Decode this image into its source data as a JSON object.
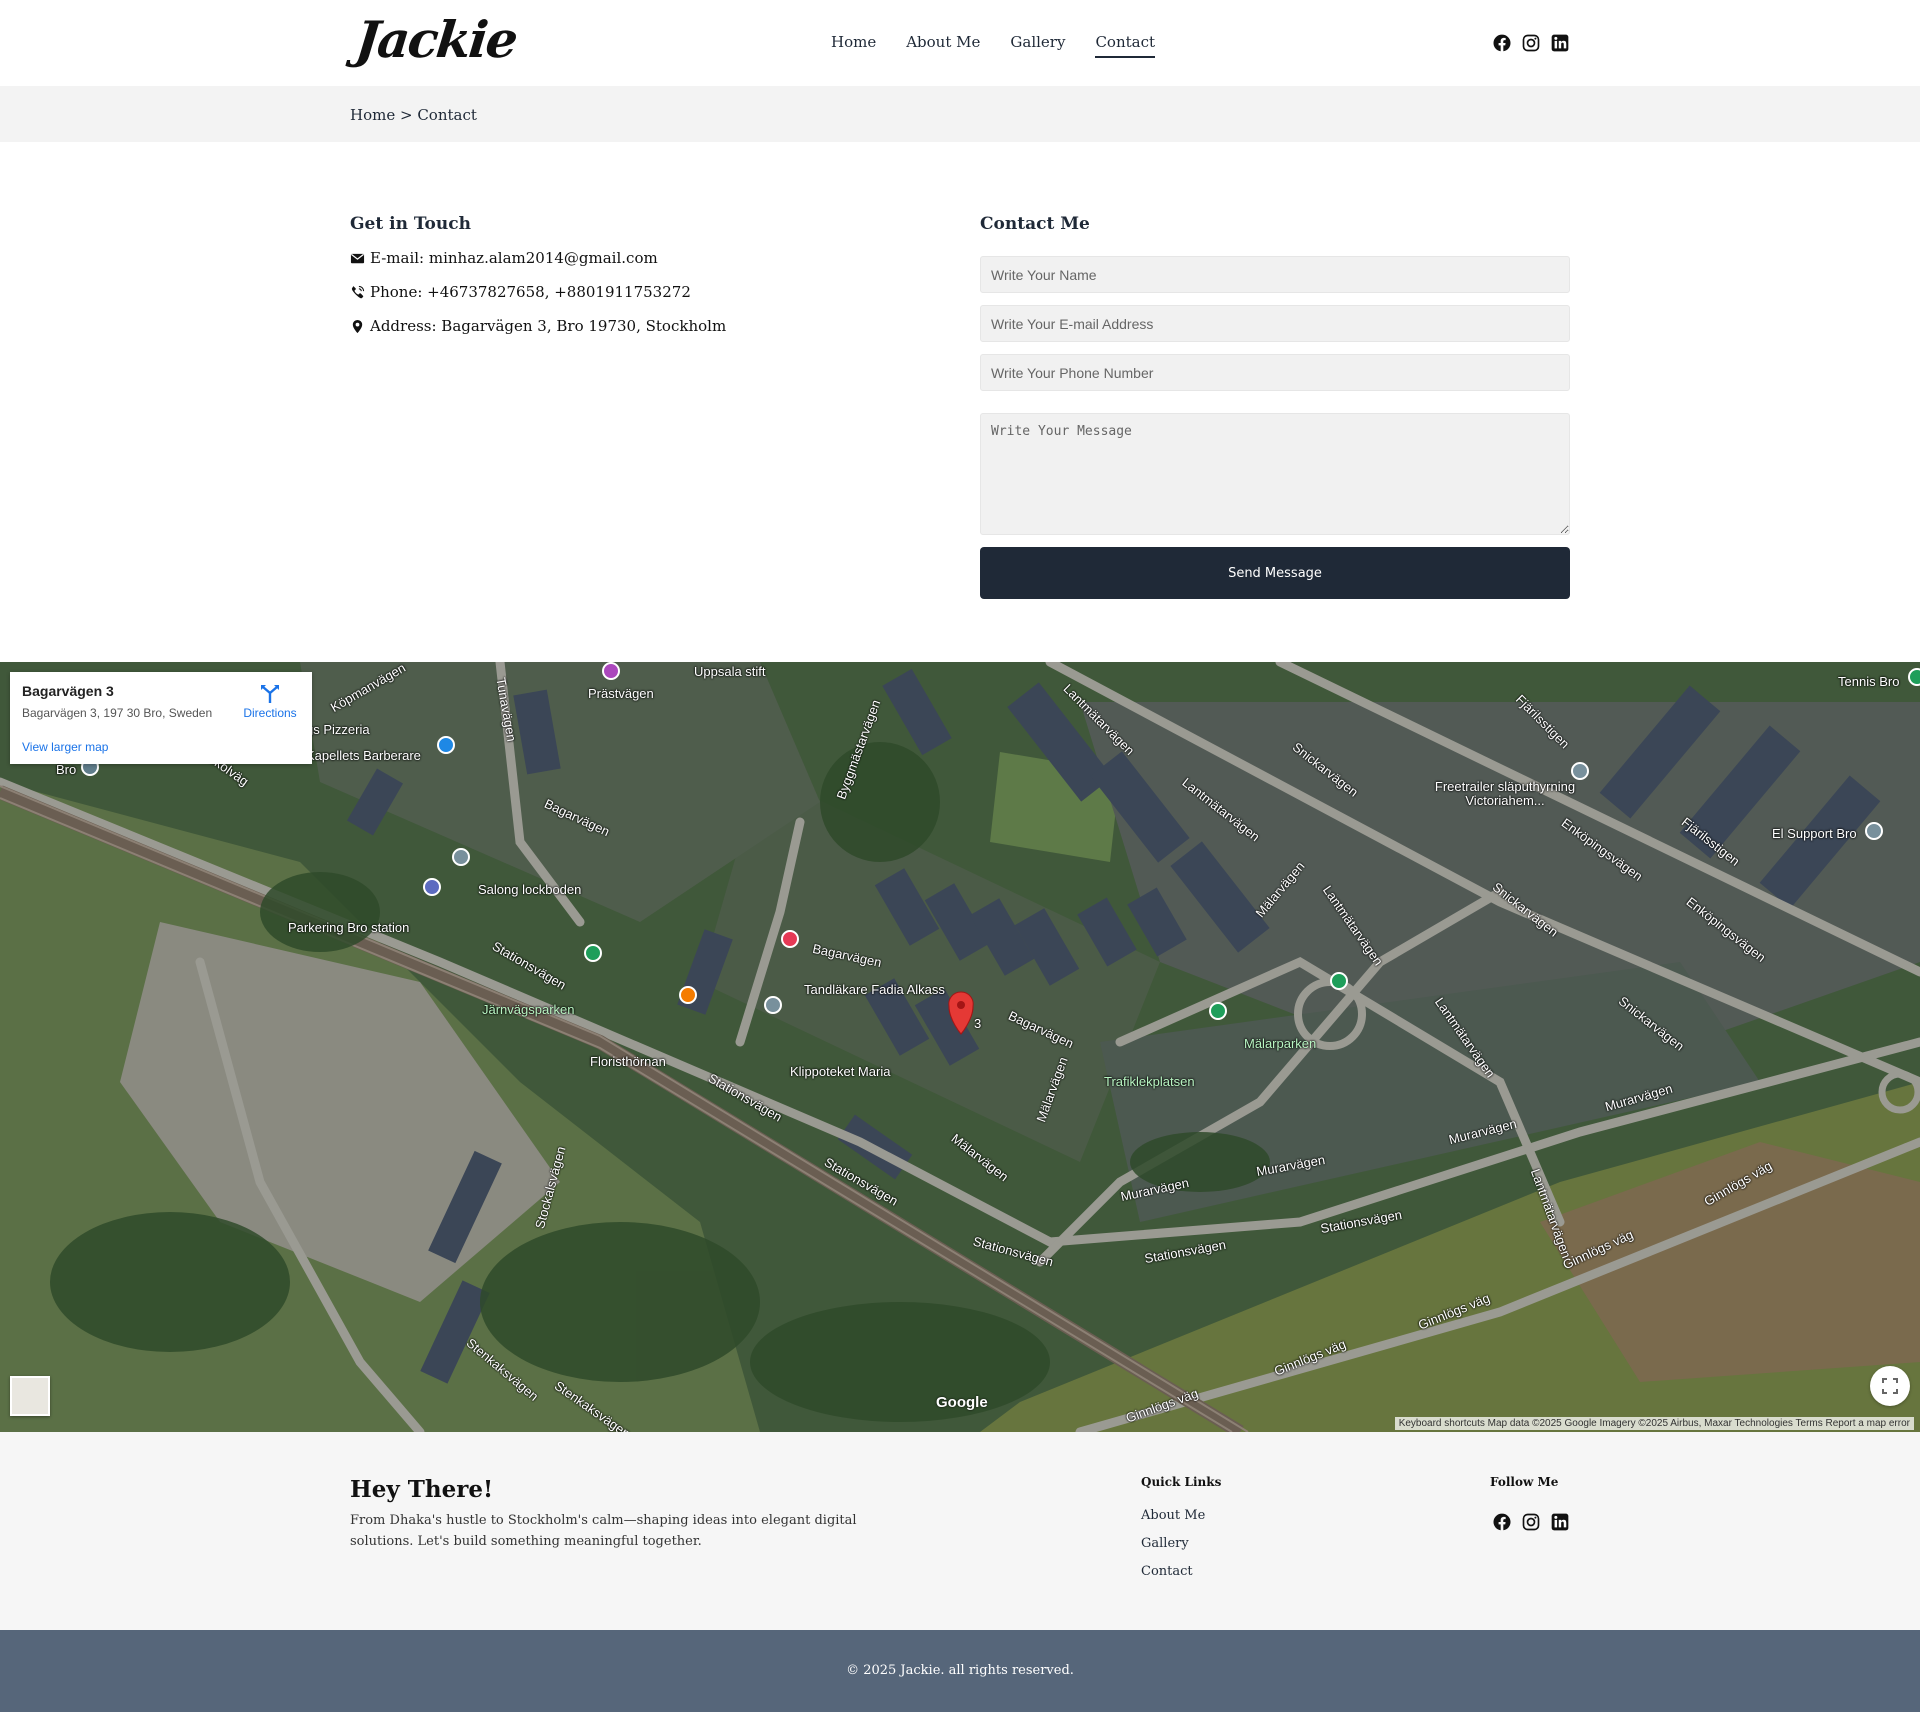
{
  "brand": {
    "logo": "Jackie"
  },
  "nav": {
    "items": [
      {
        "label": "Home"
      },
      {
        "label": "About Me"
      },
      {
        "label": "Gallery"
      },
      {
        "label": "Contact"
      }
    ]
  },
  "social": [
    "facebook-icon",
    "instagram-icon",
    "linkedin-icon"
  ],
  "breadcrumb": {
    "text": "Home > Contact"
  },
  "contact_info": {
    "title": "Get in Touch",
    "email": "E-mail: minhaz.alam2014@gmail.com",
    "phone": "Phone: +46737827658, +8801911753272",
    "address": "Address: Bagarvägen 3, Bro 19730, Stockholm"
  },
  "form": {
    "title": "Contact Me",
    "name_placeholder": "Write Your Name",
    "email_placeholder": "Write Your E-mail Address",
    "phone_placeholder": "Write Your Phone Number",
    "message_placeholder": "Write Your Message",
    "submit_label": "Send Message"
  },
  "map": {
    "card_title": "Bagarvägen 3",
    "card_address": "Bagarvägen 3, 197 30 Bro, Sweden",
    "directions_label": "Directions",
    "larger_map_label": "View larger map",
    "google_label": "Google",
    "attribution": "Keyboard shortcuts   Map data ©2025 Google Imagery ©2025 Airbus, Maxar Technologies   Terms   Report a map error",
    "labels": {
      "koepmanvagen": "Köpmanvägen",
      "pizzeria": "gs Pizzeria",
      "barberare": "Kapellets Barberare",
      "bro": "Bro",
      "skolvag": "Skolväg",
      "tunavagen": "Tunavägen",
      "prastvagen": "Prästvägen",
      "uppsala": "Uppsala stift",
      "byggmastarvagen": "Byggmästarvägen",
      "lantmatarvagen1": "Lantmätarvägen",
      "snickarvagen1": "Snickarvägen",
      "lantmatarvagen2": "Lantmätarvägen",
      "freetrailer": "Freetrailer släputhyrning Victoriahem...",
      "tennis": "Tennis Bro",
      "fjarilsstigen1": "Fjärilsstigen",
      "enkopingsvagen1": "Enköpingsvägen",
      "fjarilsstigen2": "Fjärilsstigen",
      "elsupport": "El Support Bro",
      "enkopingsvagen2": "Enköpingsvägen",
      "salong": "Salong lockboden",
      "parkering": "Parkering Bro station",
      "bagarvagen_top": "Bagarvägen",
      "stationsvagen1": "Stationsvägen",
      "jarnvagsparken": "Järnvägsparken",
      "bagarvagen2": "Bagarvägen",
      "tandlakare": "Tandläkare Fadia Alkass",
      "bagarvagen3": "Bagarvägen",
      "marker_num": "3",
      "floristhornan": "Floristhörnan",
      "klippoteket": "Klippoteket Maria",
      "stationsvagen2": "Stationsvägen",
      "malarvagen1": "Mälarvägen",
      "lantmatarvagen3": "Lantmätarvägen",
      "snickarvagen2": "Snickarvägen",
      "lantmatarvagen4": "Lantmätarvägen",
      "snickarvagen3": "Snickarvägen",
      "malarparken": "Mälarparken",
      "trafiklekplatsen": "Trafiklekplatsen",
      "malarvagen2": "Mälarvägen",
      "malarvagen3": "Mälarvägen",
      "stationsvagen3": "Stationsvägen",
      "stokkalsvagen": "Stockalsvägen",
      "muraravagen1": "Murarvägen",
      "muraravagen2": "Murarvägen",
      "muraravagen3": "Murarvägen",
      "muraravagen4": "Murarvägen",
      "stationsvagen4": "Stationsvägen",
      "stationsvagen5": "Stationsvägen",
      "stationsvagen6": "Stationsvägen",
      "lantmatarvagen5": "Lantmätarvägen",
      "ginnlogsvag1": "Ginnlögs väg",
      "ginnlogsvag2": "Ginnlögs väg",
      "ginnlogsvag3": "Ginnlögs väg",
      "ginnlogsvag4": "Ginnlögs väg",
      "ginnlogsvag5": "Ginnlögs väg",
      "stenkaksvagen1": "Stenkaksvägen",
      "stenkaksvagen2": "Stenkaksvägen"
    }
  },
  "footer": {
    "title": "Hey There!",
    "description": "From Dhaka's hustle to Stockholm's calm—shaping ideas into elegant digital solutions. Let's build something meaningful together.",
    "quick_links_title": "Quick Links",
    "quick_links": [
      {
        "label": "About Me"
      },
      {
        "label": "Gallery"
      },
      {
        "label": "Contact"
      }
    ],
    "follow_title": "Follow Me",
    "copyright": "© 2025 Jackie. all rights reserved."
  },
  "colors": {
    "dark": "#1f2937",
    "bottom_bar": "#56667a",
    "link_blue": "#1a73e8",
    "marker_red": "#e53935"
  }
}
